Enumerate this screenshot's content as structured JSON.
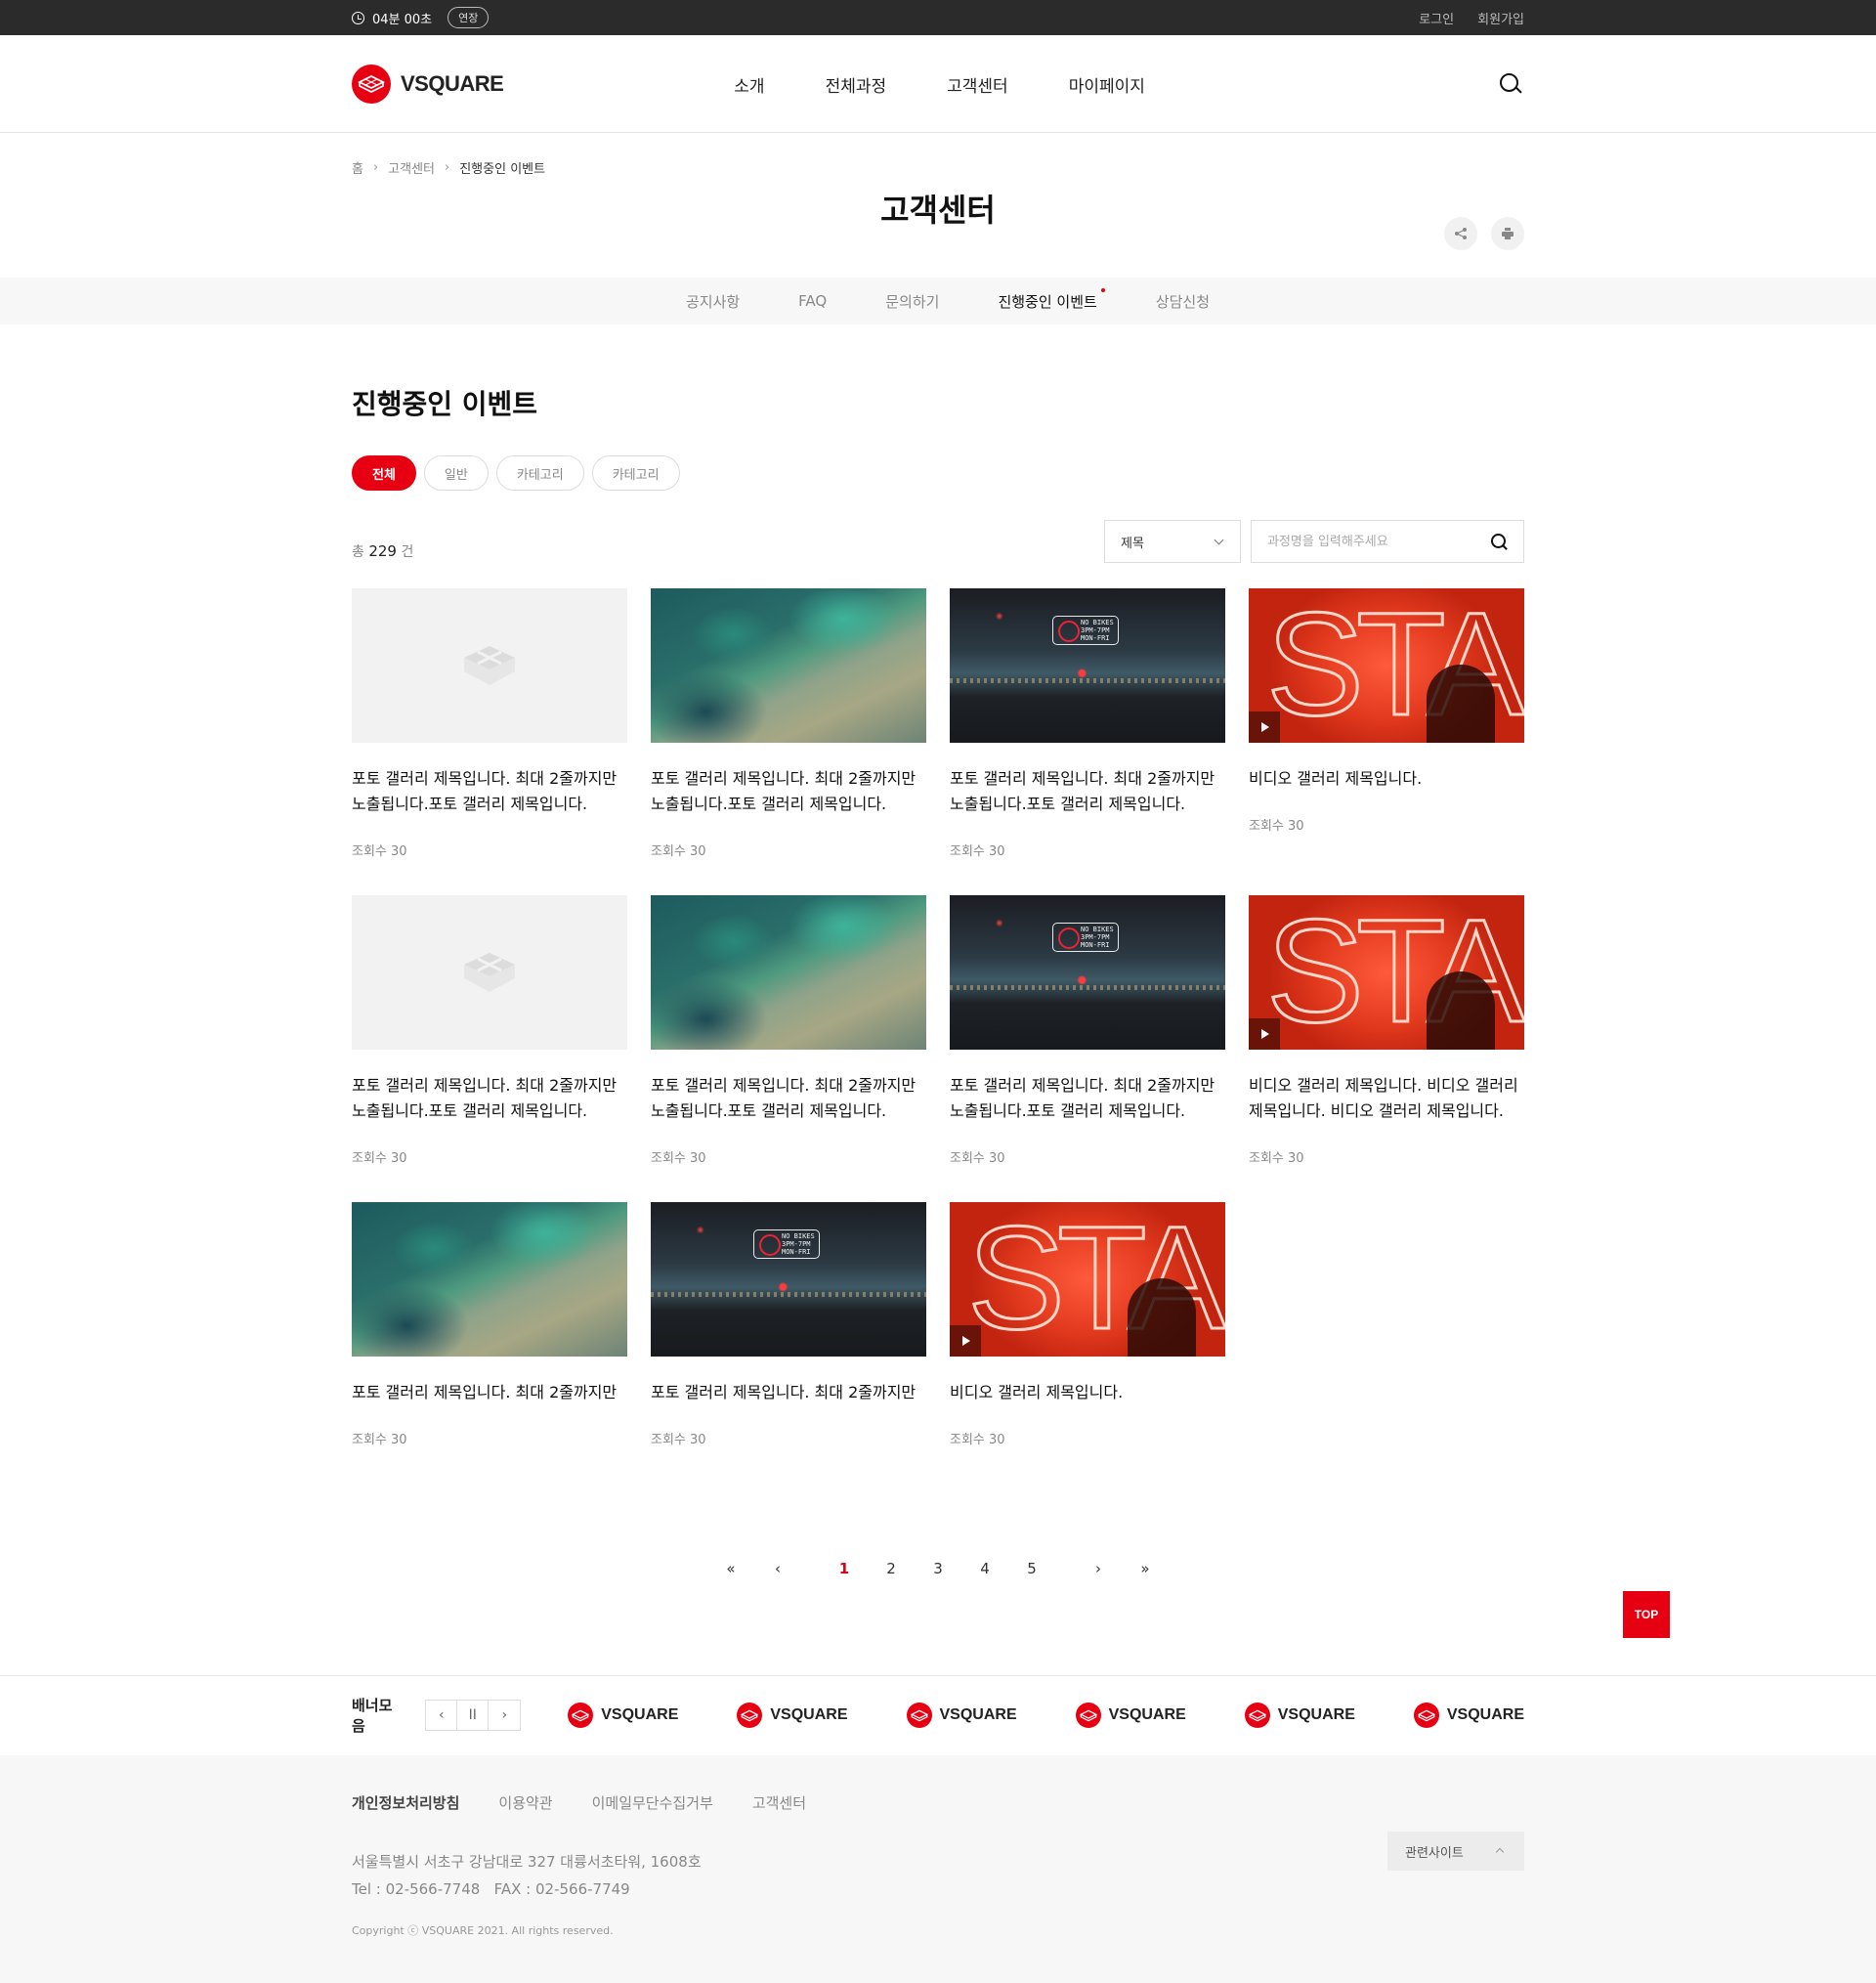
{
  "topbar": {
    "timer": "04분 00초",
    "extend_label": "연장",
    "login": "로그인",
    "signup": "회원가입"
  },
  "header": {
    "logo_text": "VSQUARE",
    "nav": [
      "소개",
      "전체과정",
      "고객센터",
      "마이페이지"
    ]
  },
  "breadcrumb": [
    "홈",
    "고객센터",
    "진행중인 이벤트"
  ],
  "page_title": "고객센터",
  "tabs": [
    "공지사항",
    "FAQ",
    "문의하기",
    "진행중인 이벤트",
    "상담신청"
  ],
  "active_tab": "진행중인 이벤트",
  "section": {
    "title": "진행중인 이벤트",
    "chips": [
      "전체",
      "일반",
      "카테고리",
      "카테고리"
    ],
    "total_prefix": "총",
    "total_count": "229",
    "total_suffix": "건",
    "select_value": "제목",
    "search_placeholder": "과정명을 입력해주세요"
  },
  "cards": [
    {
      "kind": "empty",
      "title": "포토 갤러리 제목입니다. 최대 2줄까지만 노출됩니다.포토 갤러리 제목입니다.",
      "views": "조회수 30"
    },
    {
      "kind": "aerial",
      "title": "포토 갤러리 제목입니다. 최대 2줄까지만 노출됩니다.포토 갤러리 제목입니다.",
      "views": "조회수 30"
    },
    {
      "kind": "city",
      "title": "포토 갤러리 제목입니다. 최대 2줄까지만 노출됩니다.포토 갤러리 제목입니다.",
      "views": "조회수 30"
    },
    {
      "kind": "star",
      "title": "비디오 갤러리 제목입니다.",
      "views": "조회수 30"
    },
    {
      "kind": "empty",
      "title": "포토 갤러리 제목입니다. 최대 2줄까지만 노출됩니다.포토 갤러리 제목입니다.",
      "views": "조회수 30"
    },
    {
      "kind": "aerial",
      "title": "포토 갤러리 제목입니다. 최대 2줄까지만 노출됩니다.포토 갤러리 제목입니다.",
      "views": "조회수 30"
    },
    {
      "kind": "city",
      "title": "포토 갤러리 제목입니다. 최대 2줄까지만 노출됩니다.포토 갤러리 제목입니다.",
      "views": "조회수 30"
    },
    {
      "kind": "star",
      "title": "비디오 갤러리 제목입니다. 비디오 갤러리 제목입니다. 비디오 갤러리 제목입니다.",
      "views": "조회수 30"
    },
    {
      "kind": "aerial",
      "title": "포토 갤러리 제목입니다. 최대 2줄까지만",
      "views": "조회수 30"
    },
    {
      "kind": "city",
      "title": "포토 갤러리 제목입니다. 최대 2줄까지만",
      "views": "조회수 30"
    },
    {
      "kind": "star",
      "title": "비디오 갤러리 제목입니다.",
      "views": "조회수 30"
    }
  ],
  "city_sign_text": "NO BIKES 3PM-7PM MON-FRI",
  "star_text": "STAR",
  "pagination": {
    "first": "«",
    "prev": "‹",
    "pages": [
      "1",
      "2",
      "3",
      "4",
      "5"
    ],
    "current": "1",
    "next": "›",
    "last": "»"
  },
  "top_button": "TOP",
  "banners": {
    "label": "배너모음",
    "prev": "‹",
    "pause": "II",
    "next": "›",
    "logos": [
      "VSQUARE",
      "VSQUARE",
      "VSQUARE",
      "VSQUARE",
      "VSQUARE",
      "VSQUARE"
    ]
  },
  "footer": {
    "links": [
      "개인정보처리방침",
      "이용약관",
      "이메일무단수집거부",
      "고객센터"
    ],
    "related": "관련사이트",
    "address": "서울특별시 서초구 강남대로 327 대륭서초타워, 1608호",
    "tel": "Tel : 02-566-7748   FAX : 02-566-7749",
    "copyright": "Copyright ⓒ VSQUARE 2021. All rights reserved."
  },
  "colors": {
    "brand": "#e60012",
    "topbar": "#2b2b2b",
    "text": "#222222"
  },
  "icons": [
    "clock-icon",
    "search-icon",
    "share-icon",
    "print-icon",
    "play-icon",
    "logo-icon"
  ]
}
